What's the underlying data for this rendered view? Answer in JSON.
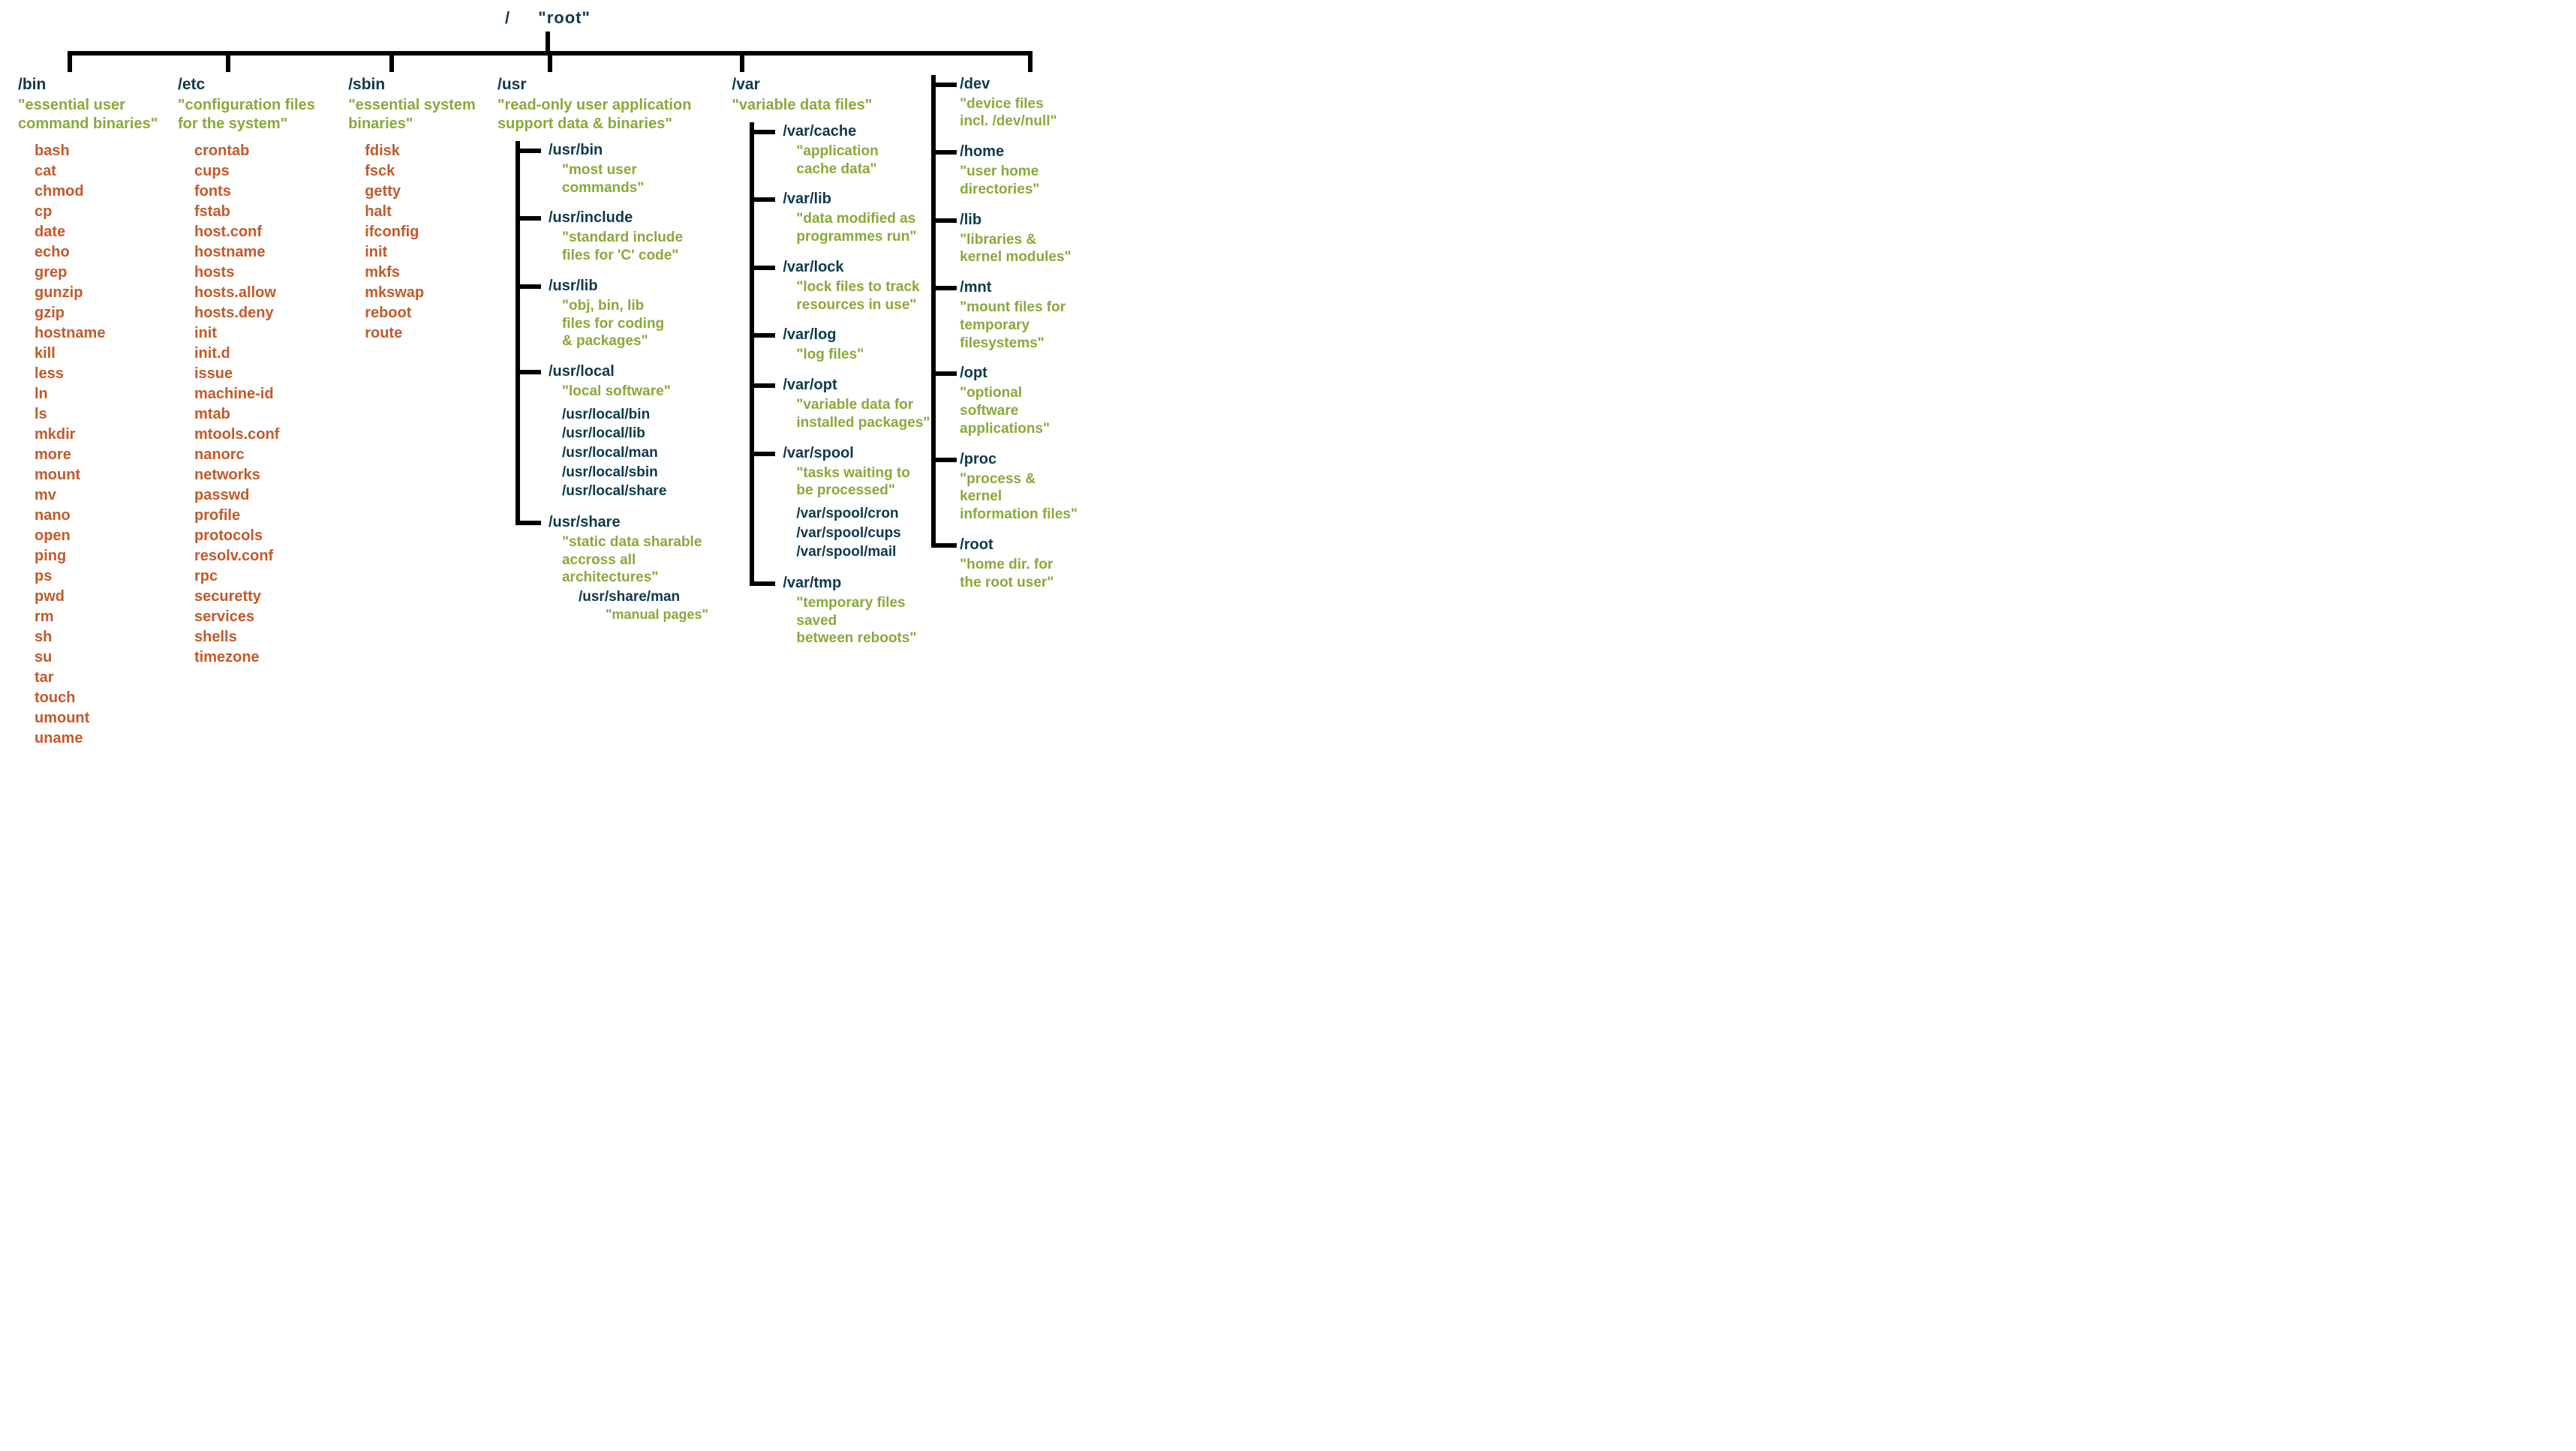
{
  "root": {
    "path": "/",
    "label": "\"root\""
  },
  "columns": {
    "bin": {
      "title": "/bin",
      "desc": "\"essential user\ncommand binaries\"",
      "files": [
        "bash",
        "cat",
        "chmod",
        "cp",
        "date",
        "echo",
        "grep",
        "gunzip",
        "gzip",
        "hostname",
        "kill",
        "less",
        "ln",
        "ls",
        "mkdir",
        "more",
        "mount",
        "mv",
        "nano",
        "open",
        "ping",
        "ps",
        "pwd",
        "rm",
        "sh",
        "su",
        "tar",
        "touch",
        "umount",
        "uname"
      ]
    },
    "etc": {
      "title": "/etc",
      "desc": "\"configuration files\nfor the system\"",
      "files": [
        "crontab",
        "cups",
        "fonts",
        "fstab",
        "host.conf",
        "hostname",
        "hosts",
        "hosts.allow",
        "hosts.deny",
        "init",
        "init.d",
        "issue",
        "machine-id",
        "mtab",
        "mtools.conf",
        "nanorc",
        "networks",
        "passwd",
        "profile",
        "protocols",
        "resolv.conf",
        "rpc",
        "securetty",
        "services",
        "shells",
        "timezone"
      ]
    },
    "sbin": {
      "title": "/sbin",
      "desc": "\"essential system\nbinaries\"",
      "files": [
        "fdisk",
        "fsck",
        "getty",
        "halt",
        "ifconfig",
        "init",
        "mkfs",
        "mkswap",
        "reboot",
        "route"
      ]
    },
    "usr": {
      "title": "/usr",
      "desc": "\"read-only user application\nsupport data & binaries\"",
      "children": [
        {
          "title": "/usr/bin",
          "desc": "\"most user\ncommands\""
        },
        {
          "title": "/usr/include",
          "desc": "\"standard include\nfiles for 'C' code\""
        },
        {
          "title": "/usr/lib",
          "desc": "\"obj, bin, lib\nfiles for coding\n& packages\""
        },
        {
          "title": "/usr/local",
          "desc": "\"local software\"",
          "list": [
            "/usr/local/bin",
            "/usr/local/lib",
            "/usr/local/man",
            "/usr/local/sbin",
            "/usr/local/share"
          ]
        },
        {
          "title": "/usr/share",
          "desc": "\"static data sharable\naccross all architectures\"",
          "sub": {
            "title": "/usr/share/man",
            "desc": "\"manual pages\""
          }
        }
      ]
    },
    "var": {
      "title": "/var",
      "desc": "\"variable data files\"",
      "children": [
        {
          "title": "/var/cache",
          "desc": "\"application\ncache data\""
        },
        {
          "title": "/var/lib",
          "desc": "\"data modified as\nprogrammes run\""
        },
        {
          "title": "/var/lock",
          "desc": "\"lock files to track\nresources in use\""
        },
        {
          "title": "/var/log",
          "desc": "\"log files\""
        },
        {
          "title": "/var/opt",
          "desc": "\"variable data for\ninstalled packages\""
        },
        {
          "title": "/var/spool",
          "desc": "\"tasks waiting to\nbe processed\"",
          "list": [
            "/var/spool/cron",
            "/var/spool/cups",
            "/var/spool/mail"
          ]
        },
        {
          "title": "/var/tmp",
          "desc": "\"temporary files saved\nbetween reboots\""
        }
      ]
    },
    "side": {
      "children": [
        {
          "title": "/dev",
          "desc": "\"device files\nincl. /dev/null\""
        },
        {
          "title": "/home",
          "desc": "\"user home\ndirectories\""
        },
        {
          "title": "/lib",
          "desc": "\"libraries &\nkernel modules\""
        },
        {
          "title": "/mnt",
          "desc": "\"mount files for\ntemporary\nfilesystems\""
        },
        {
          "title": "/opt",
          "desc": "\"optional software\napplications\""
        },
        {
          "title": "/proc",
          "desc": "\"process & kernel\ninformation files\""
        },
        {
          "title": "/root",
          "desc": "\"home dir. for\nthe root user\""
        }
      ]
    }
  }
}
